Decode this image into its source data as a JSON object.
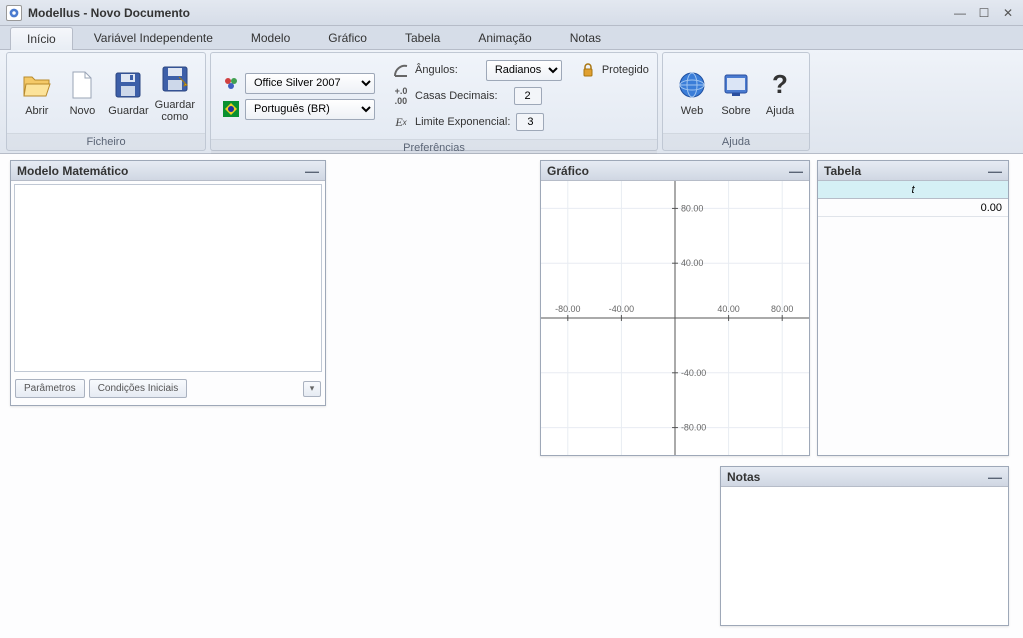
{
  "window": {
    "title": "Modellus - Novo Documento"
  },
  "tabs": {
    "inicio": "Início",
    "variavel": "Variável Independente",
    "modelo": "Modelo",
    "grafico": "Gráfico",
    "tabela": "Tabela",
    "animacao": "Animação",
    "notas": "Notas"
  },
  "ribbon": {
    "ficheiro": {
      "label": "Ficheiro",
      "abrir": "Abrir",
      "novo": "Novo",
      "guardar": "Guardar",
      "guardar_como": "Guardar\ncomo"
    },
    "preferencias": {
      "label": "Preferências",
      "theme_value": "Office Silver 2007",
      "lang_value": "Português (BR)",
      "angulos_label": "Ângulos:",
      "angulos_value": "Radianos",
      "casas_label": "Casas Decimais:",
      "casas_value": "2",
      "limite_label": "Limite Exponencial:",
      "limite_value": "3",
      "protegido": "Protegido"
    },
    "ajuda": {
      "label": "Ajuda",
      "web": "Web",
      "sobre": "Sobre",
      "ajuda": "Ajuda"
    }
  },
  "panels": {
    "modelo": {
      "title": "Modelo Matemático",
      "parametros": "Parâmetros",
      "condicoes": "Condições Iniciais"
    },
    "grafico": {
      "title": "Gráfico"
    },
    "tabela": {
      "title": "Tabela",
      "col_header": "t",
      "row0": "0.00"
    },
    "notas": {
      "title": "Notas"
    }
  },
  "chart_data": {
    "type": "scatter",
    "series": [],
    "xlim": [
      -100,
      100
    ],
    "ylim": [
      -100,
      100
    ],
    "x_ticks": [
      -80,
      -40,
      40,
      80
    ],
    "y_ticks": [
      -80,
      -40,
      40,
      80
    ],
    "title": "",
    "xlabel": "",
    "ylabel": ""
  }
}
